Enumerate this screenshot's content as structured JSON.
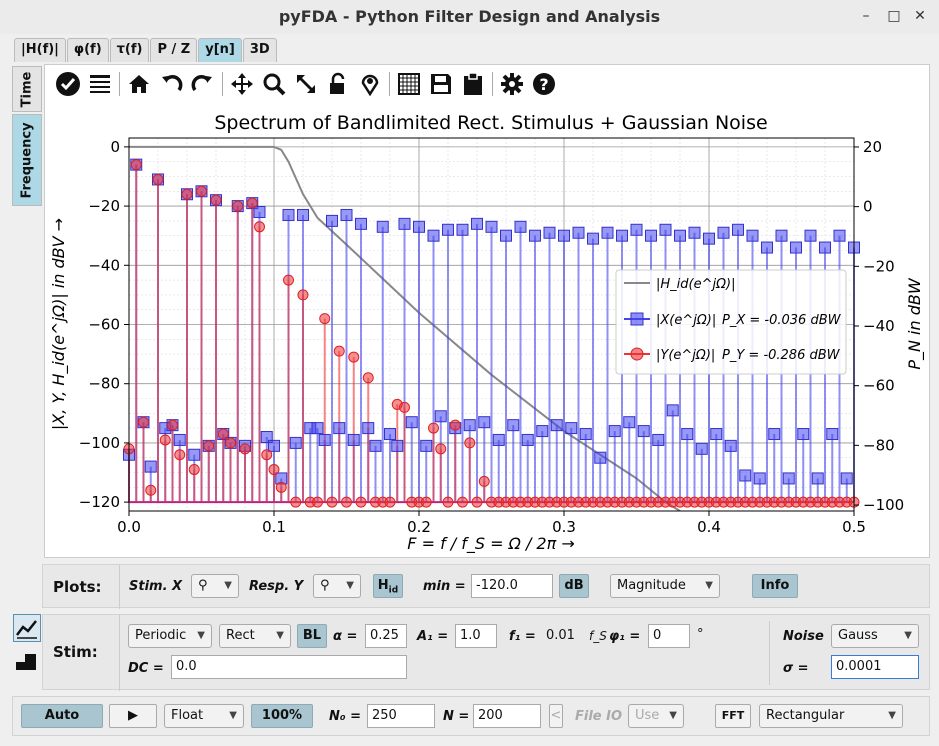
{
  "window": {
    "title": "pyFDA - Python Filter Design and Analysis"
  },
  "tabs": [
    {
      "label": "|H(f)|"
    },
    {
      "label": "φ(f)"
    },
    {
      "label": "τ(f)"
    },
    {
      "label": "P / Z"
    },
    {
      "label": "y[n]",
      "active": true
    },
    {
      "label": "3D"
    }
  ],
  "side_tabs": [
    {
      "label": "Time"
    },
    {
      "label": "Frequency",
      "active": true
    }
  ],
  "toolbar_icons": [
    "check-circle-icon",
    "menu-lines-icon",
    "home-icon",
    "undo-icon",
    "redo-icon",
    "pan-icon",
    "zoom-icon",
    "zoom-full-icon",
    "lock-icon",
    "marker-icon",
    "grid-icon",
    "save-icon",
    "clipboard-icon",
    "gear-icon",
    "help-icon"
  ],
  "chart_data": {
    "type": "line",
    "title": "Spectrum of Bandlimited Rect. Stimulus + Gaussian Noise",
    "xlabel": "F = f / f_S = Ω / 2π →",
    "ylabel": "|X, Y, H_id(e^jΩ)| in dBV →",
    "ylabel_right": "P_N in dBW",
    "xlim": [
      0.0,
      0.5
    ],
    "ylim": [
      -123,
      3
    ],
    "ylim_right": [
      -102,
      23
    ],
    "x_ticks": [
      "0.0",
      "0.1",
      "0.2",
      "0.3",
      "0.4",
      "0.5"
    ],
    "y_ticks": [
      "0",
      "−20",
      "−40",
      "−60",
      "−80",
      "−100",
      "−120"
    ],
    "y_ticks_right": [
      "20",
      "0",
      "−20",
      "−40",
      "−60",
      "−80",
      "−100"
    ],
    "grid": true,
    "legend_position": "center-right",
    "legend": [
      {
        "name": "|H_id(e^jΩ)|",
        "value": ""
      },
      {
        "name": "|X(e^jΩ)|",
        "value": "P_X = -0.036 dBW"
      },
      {
        "name": "|Y(e^jΩ)|",
        "value": "P_Y = -0.286 dBW"
      }
    ],
    "x": [
      0.0,
      0.005,
      0.01,
      0.015,
      0.02,
      0.025,
      0.03,
      0.035,
      0.04,
      0.045,
      0.05,
      0.055,
      0.06,
      0.065,
      0.07,
      0.075,
      0.08,
      0.085,
      0.09,
      0.095,
      0.1,
      0.105,
      0.11,
      0.115,
      0.12,
      0.125,
      0.13,
      0.135,
      0.14,
      0.145,
      0.15,
      0.155,
      0.16,
      0.165,
      0.17,
      0.175,
      0.18,
      0.185,
      0.19,
      0.195,
      0.2,
      0.205,
      0.21,
      0.215,
      0.22,
      0.225,
      0.23,
      0.235,
      0.24,
      0.245,
      0.25,
      0.255,
      0.26,
      0.265,
      0.27,
      0.275,
      0.28,
      0.285,
      0.29,
      0.295,
      0.3,
      0.305,
      0.31,
      0.315,
      0.32,
      0.325,
      0.33,
      0.335,
      0.34,
      0.345,
      0.35,
      0.355,
      0.36,
      0.365,
      0.37,
      0.375,
      0.38,
      0.385,
      0.39,
      0.395,
      0.4,
      0.405,
      0.41,
      0.415,
      0.42,
      0.425,
      0.43,
      0.435,
      0.44,
      0.445,
      0.45,
      0.455,
      0.46,
      0.465,
      0.47,
      0.475,
      0.48,
      0.485,
      0.49,
      0.495,
      0.5
    ],
    "series": [
      {
        "name": "|X(e^jΩ)|",
        "color": "#4444ee",
        "marker": "square",
        "values": [
          -104,
          -6,
          -93,
          -108,
          -11,
          -95,
          -94,
          -99,
          -16,
          -104,
          -15,
          -101,
          -18,
          -97,
          -100,
          -20,
          -101,
          -19,
          -22,
          -98,
          -101,
          -112,
          -23,
          -100,
          -23,
          -95,
          -95,
          -99,
          -25,
          -95,
          -23,
          -99,
          -26,
          -95,
          -101,
          -27,
          -97,
          -101,
          -26,
          -93,
          -27,
          -101,
          -30,
          -91,
          -28,
          -95,
          -28,
          -94,
          -26,
          -93,
          -27,
          -99,
          -30,
          -94,
          -27,
          -99,
          -30,
          -96,
          -29,
          -94,
          -30,
          -95,
          -29,
          -97,
          -31,
          -105,
          -29,
          -96,
          -30,
          -93,
          -28,
          -96,
          -30,
          -99,
          -28,
          -89,
          -30,
          -97,
          -29,
          -102,
          -31,
          -97,
          -29,
          -101,
          -28,
          -111,
          -30,
          -112,
          -34,
          -97,
          -30,
          -112,
          -34,
          -97,
          -30,
          -112,
          -34,
          -97,
          -30,
          -112,
          -34
        ]
      },
      {
        "name": "|Y(e^jΩ)|",
        "color": "#ee3333",
        "marker": "circle",
        "values": [
          -102,
          -6,
          -93,
          -116,
          -11,
          -99,
          -94,
          -104,
          -16,
          -109,
          -15,
          -101,
          -18,
          -97,
          -100,
          -20,
          -102,
          -19,
          -27,
          -104,
          -109,
          -115,
          -45,
          -120,
          -50,
          -120,
          -120,
          -58,
          -120,
          -69,
          -120,
          -71,
          -120,
          -78,
          -120,
          -120,
          -120,
          -87,
          -88,
          -120,
          -120,
          -120,
          -95,
          -102,
          -120,
          -94,
          -120,
          -100,
          -120,
          -113,
          -120,
          -120,
          -120,
          -120,
          -120,
          -120,
          -120,
          -120,
          -120,
          -120,
          -120,
          -120,
          -120,
          -120,
          -120,
          -120,
          -120,
          -120,
          -120,
          -120,
          -120,
          -120,
          -120,
          -120,
          -120,
          -120,
          -120,
          -120,
          -120,
          -120,
          -120,
          -120,
          -120,
          -120,
          -120,
          -120,
          -120,
          -120,
          -120,
          -120,
          -120,
          -120,
          -120,
          -120,
          -120,
          -120,
          -120,
          -120,
          -120,
          -120,
          -120
        ]
      },
      {
        "name": "|H_id(e^jΩ)|",
        "color": "#888888",
        "marker": "none",
        "x": [
          0.0,
          0.09,
          0.1,
          0.105,
          0.11,
          0.12,
          0.13,
          0.15,
          0.2,
          0.25,
          0.3,
          0.35,
          0.37,
          0.38
        ],
        "values": [
          0,
          0,
          0,
          -1,
          -5,
          -16,
          -24,
          -33,
          -56,
          -77,
          -96,
          -112,
          -120,
          -123
        ]
      }
    ]
  },
  "plots_row": {
    "label": "Plots:",
    "stim_label": "Stim. X",
    "resp_label": "Resp. Y",
    "hid_label": "H",
    "hid_sub": "id",
    "min_label": "min =",
    "min_value": "-120.0",
    "db_label": "dB",
    "mode_value": "Magnitude",
    "info_label": "Info"
  },
  "stim_row": {
    "label": "Stim:",
    "type_value": "Periodic",
    "shape_value": "Rect",
    "bl_label": "BL",
    "alpha_label": "α =",
    "alpha_value": "0.25",
    "a1_label": "A₁ =",
    "a1_value": "1.0",
    "f1_label": "f₁ =",
    "f1_value": "0.01",
    "fs_unit": "f_S",
    "phi_label": "φ₁ =",
    "phi_value": "0",
    "phi_unit": "°",
    "dc_label": "DC =",
    "dc_value": "0.0",
    "noise_label": "Noise",
    "noise_value": "Gauss",
    "sigma_label": "σ =",
    "sigma_value": "0.0001"
  },
  "bottom_row": {
    "auto_label": "Auto",
    "format_value": "Float",
    "progress_label": "100%",
    "n0_label": "N₀ =",
    "n0_value": "250",
    "n_label": "N =",
    "n_value": "200",
    "fileio_label": "File IO",
    "use_value": "Use",
    "fft_label": "FFT",
    "window_value": "Rectangular"
  }
}
